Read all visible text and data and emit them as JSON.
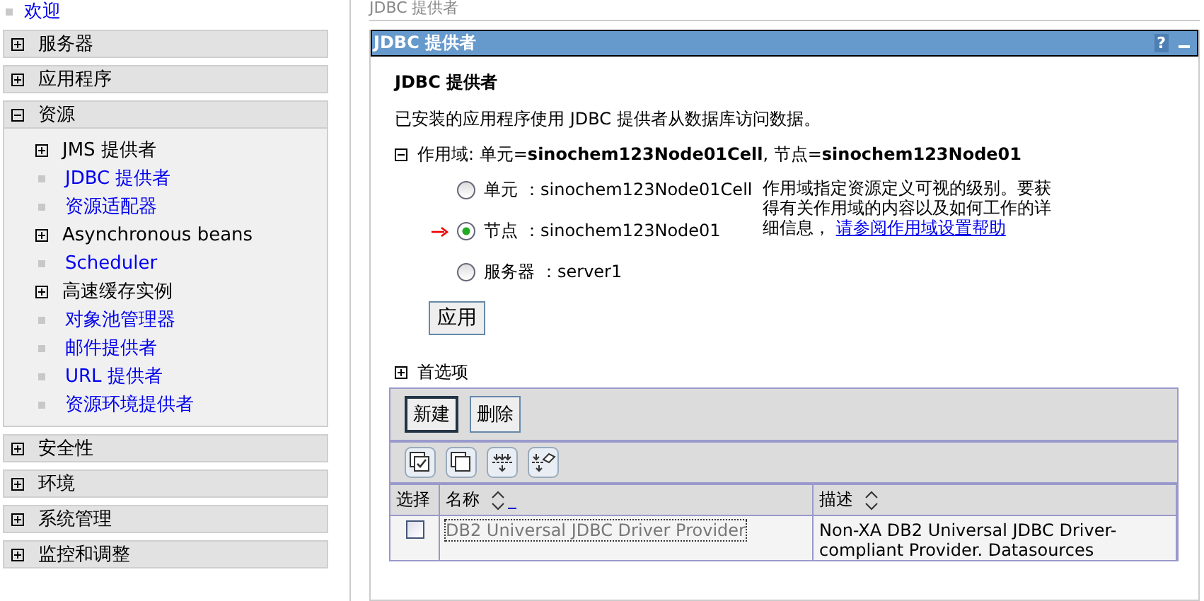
{
  "nav": {
    "welcome": "欢迎",
    "sections": [
      {
        "label": "服务器",
        "expanded": false
      },
      {
        "label": "应用程序",
        "expanded": false
      },
      {
        "label": "资源",
        "expanded": true,
        "children": [
          {
            "label": "JMS 提供者",
            "kind": "group"
          },
          {
            "label": "JDBC 提供者",
            "kind": "link"
          },
          {
            "label": "资源适配器",
            "kind": "link"
          },
          {
            "label": "Asynchronous beans",
            "kind": "group"
          },
          {
            "label": "Scheduler",
            "kind": "link"
          },
          {
            "label": "高速缓存实例",
            "kind": "group"
          },
          {
            "label": "对象池管理器",
            "kind": "link"
          },
          {
            "label": "邮件提供者",
            "kind": "link"
          },
          {
            "label": "URL 提供者",
            "kind": "link"
          },
          {
            "label": "资源环境提供者",
            "kind": "link"
          }
        ]
      },
      {
        "label": "安全性",
        "expanded": false
      },
      {
        "label": "环境",
        "expanded": false
      },
      {
        "label": "系统管理",
        "expanded": false
      },
      {
        "label": "监控和调整",
        "expanded": false
      }
    ]
  },
  "breadcrumb": "JDBC 提供者",
  "panel": {
    "title": "JDBC 提供者",
    "help": "?",
    "heading": "JDBC 提供者",
    "description": "已安装的应用程序使用 JDBC 提供者从数据库访问数据。",
    "scope": {
      "label": "作用域: 单元=**sinochem123Node01Cell**, 节点=**sinochem123Node01**",
      "expanded": true,
      "options": [
        {
          "label": "单元",
          "value": "：sinochem123Node01Cell",
          "selected": false,
          "current": false
        },
        {
          "label": "节点",
          "value": "：sinochem123Node01",
          "selected": true,
          "current": true
        },
        {
          "label": "服务器",
          "value": "：server1",
          "selected": false,
          "current": false
        }
      ],
      "help_text": "作用域指定资源定义可视的级别。要获得有关作用域的内容以及如何工作的详细信息，",
      "help_link": "请参阅作用域设置帮助",
      "apply": "应用"
    },
    "preferences": {
      "label": "首选项",
      "expanded": false
    },
    "table": {
      "buttons": [
        {
          "label": "新建",
          "focused": true
        },
        {
          "label": "删除",
          "focused": false
        }
      ],
      "tools": [
        {
          "kind": "select-all"
        },
        {
          "kind": "deselect-all"
        },
        {
          "kind": "filter"
        },
        {
          "kind": "clear-filter"
        }
      ],
      "columns": [
        {
          "label": "选择",
          "sortable": false
        },
        {
          "label": "名称",
          "sortable": true,
          "sorted": true
        },
        {
          "label": "描述",
          "sortable": true,
          "sorted": false
        }
      ],
      "rows": [
        {
          "checked": false,
          "name": "DB2 Universal JDBC Driver Provider",
          "description": "Non-XA DB2 Universal JDBC Driver-compliant Provider. Datasources"
        }
      ]
    }
  }
}
